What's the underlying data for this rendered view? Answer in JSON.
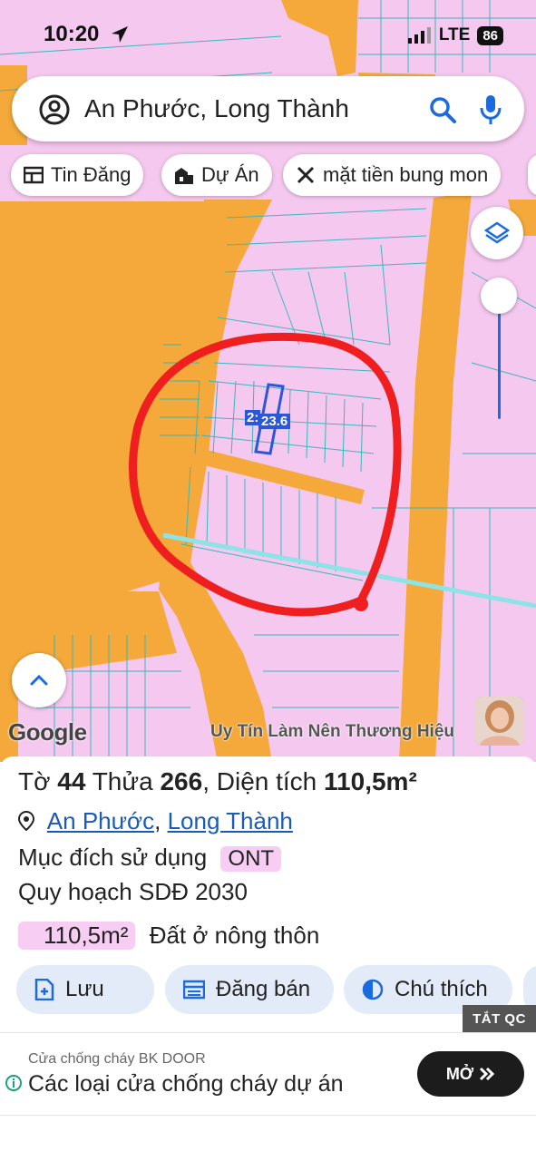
{
  "status_bar": {
    "time": "10:20",
    "network": "LTE",
    "battery": "86"
  },
  "search": {
    "query": "An Phước, Long Thành"
  },
  "chips": [
    {
      "label": "Tin Đăng",
      "icon": "newspaper-icon"
    },
    {
      "label": "Dự Án",
      "icon": "building-icon"
    },
    {
      "label": "mặt tiền bung mon",
      "icon": "ruler-icon"
    }
  ],
  "map": {
    "parcel_label_left": "2:",
    "parcel_label": "23.6",
    "google_logo": "Google",
    "watermark": "Uy Tín Làm Nên Thương Hiệu",
    "colors": {
      "residential": "#f5c8ef",
      "road": "#f4a93a",
      "commercial": "#f2aaa6",
      "boundary": "#39b8b8",
      "marker": "#ef1f1f"
    }
  },
  "parcel": {
    "to_label": "Tờ",
    "to_number": "44",
    "thua_label": "Thửa",
    "thua_number": "266",
    "area_label": ", Diện tích",
    "area_value": "110,5m²",
    "location_ward": "An Phước",
    "location_sep": ",",
    "location_district": "Long Thành",
    "purpose_label": "Mục đích sử dụng",
    "purpose_code": "ONT",
    "plan_label": "Quy hoạch SDĐ 2030",
    "plan_area": "110,5m²",
    "plan_type": "Đất ở nông thôn"
  },
  "actions": [
    {
      "label": "Lưu",
      "icon": "save-icon"
    },
    {
      "label": "Đăng bán",
      "icon": "listing-icon"
    },
    {
      "label": "Chú thích",
      "icon": "legend-icon"
    }
  ],
  "ad": {
    "close_label": "TẮT QC",
    "sponsor": "Cửa chống cháy BK DOOR",
    "title": "Các loại cửa chống cháy dự án",
    "cta": "MỞ",
    "cta_icon": "double-chevron-icon"
  }
}
